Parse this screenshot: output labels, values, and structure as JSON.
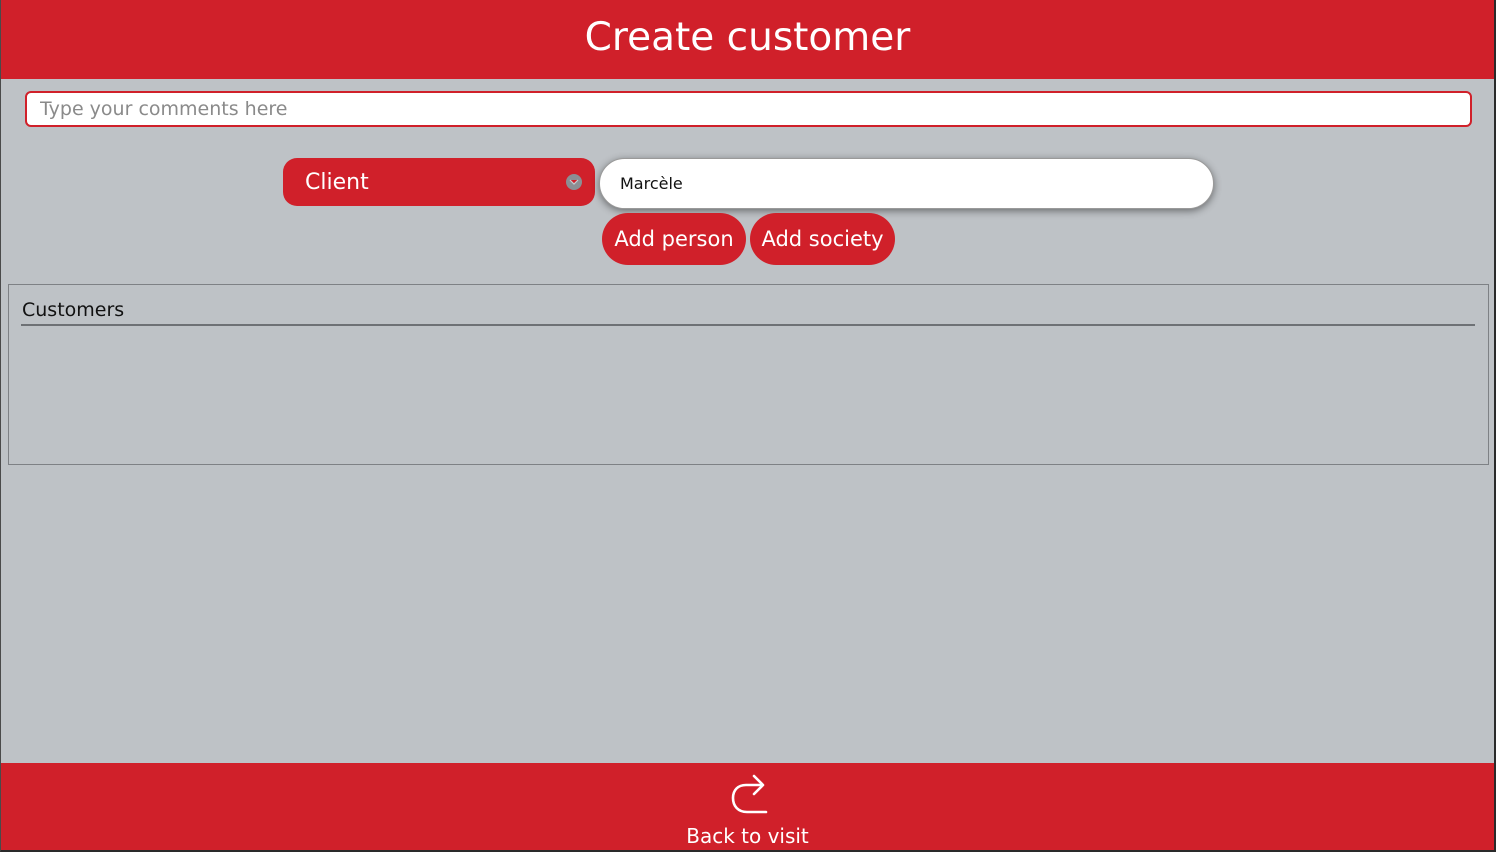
{
  "header": {
    "title": "Create customer"
  },
  "comments": {
    "placeholder": "Type your comments here",
    "value": ""
  },
  "client_select": {
    "selected": "Client",
    "icon": "chevron-down-icon"
  },
  "name_input": {
    "value": "Marcèle"
  },
  "actions": {
    "add_person_label": "Add person",
    "add_society_label": "Add society"
  },
  "customers": {
    "title": "Customers",
    "items": []
  },
  "footer": {
    "back_label": "Back to visit",
    "icon": "return-arrow-icon"
  },
  "colors": {
    "accent": "#d0202a",
    "background": "#bec2c6",
    "text_on_accent": "#ffffff"
  }
}
